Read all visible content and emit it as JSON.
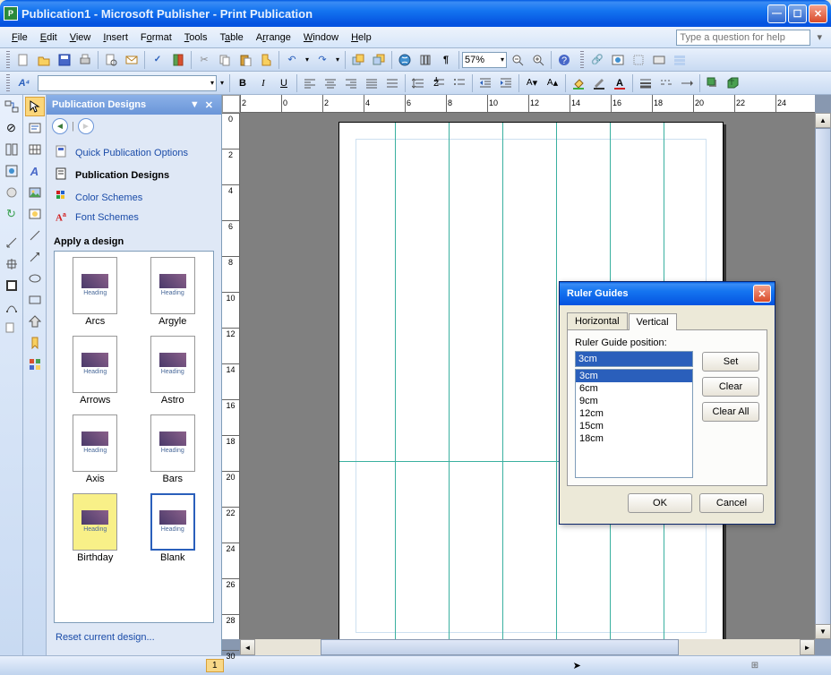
{
  "titlebar": {
    "title": "Publication1 - Microsoft Publisher - Print Publication"
  },
  "menubar": {
    "items": [
      "File",
      "Edit",
      "View",
      "Insert",
      "Format",
      "Tools",
      "Table",
      "Arrange",
      "Window",
      "Help"
    ],
    "help_placeholder": "Type a question for help"
  },
  "toolbar": {
    "zoom": "57%"
  },
  "taskpane": {
    "title": "Publication Designs",
    "links": {
      "quick": "Quick Publication Options",
      "designs": "Publication Designs",
      "color": "Color Schemes",
      "font": "Font Schemes"
    },
    "apply_label": "Apply a design",
    "designs_list": [
      "Arcs",
      "Argyle",
      "Arrows",
      "Astro",
      "Axis",
      "Bars",
      "Birthday",
      "Blank"
    ],
    "selected": "Blank",
    "reset": "Reset current design..."
  },
  "statusbar": {
    "page": "1"
  },
  "dialog": {
    "title": "Ruler Guides",
    "tabs": [
      "Horizontal",
      "Vertical"
    ],
    "active_tab": "Vertical",
    "label": "Ruler Guide position:",
    "input_value": "3cm",
    "positions": [
      "3cm",
      "6cm",
      "9cm",
      "12cm",
      "15cm",
      "18cm"
    ],
    "selected_pos": "3cm",
    "buttons": {
      "set": "Set",
      "clear": "Clear",
      "clearall": "Clear All",
      "ok": "OK",
      "cancel": "Cancel"
    }
  },
  "ruler": {
    "hticks": [
      "2",
      "0",
      "2",
      "4",
      "6",
      "8",
      "10",
      "12",
      "14",
      "16",
      "18",
      "20",
      "22",
      "24"
    ],
    "vticks": [
      "0",
      "2",
      "4",
      "6",
      "8",
      "10",
      "12",
      "14",
      "16",
      "18",
      "20",
      "22",
      "24",
      "26",
      "28",
      "30"
    ]
  }
}
